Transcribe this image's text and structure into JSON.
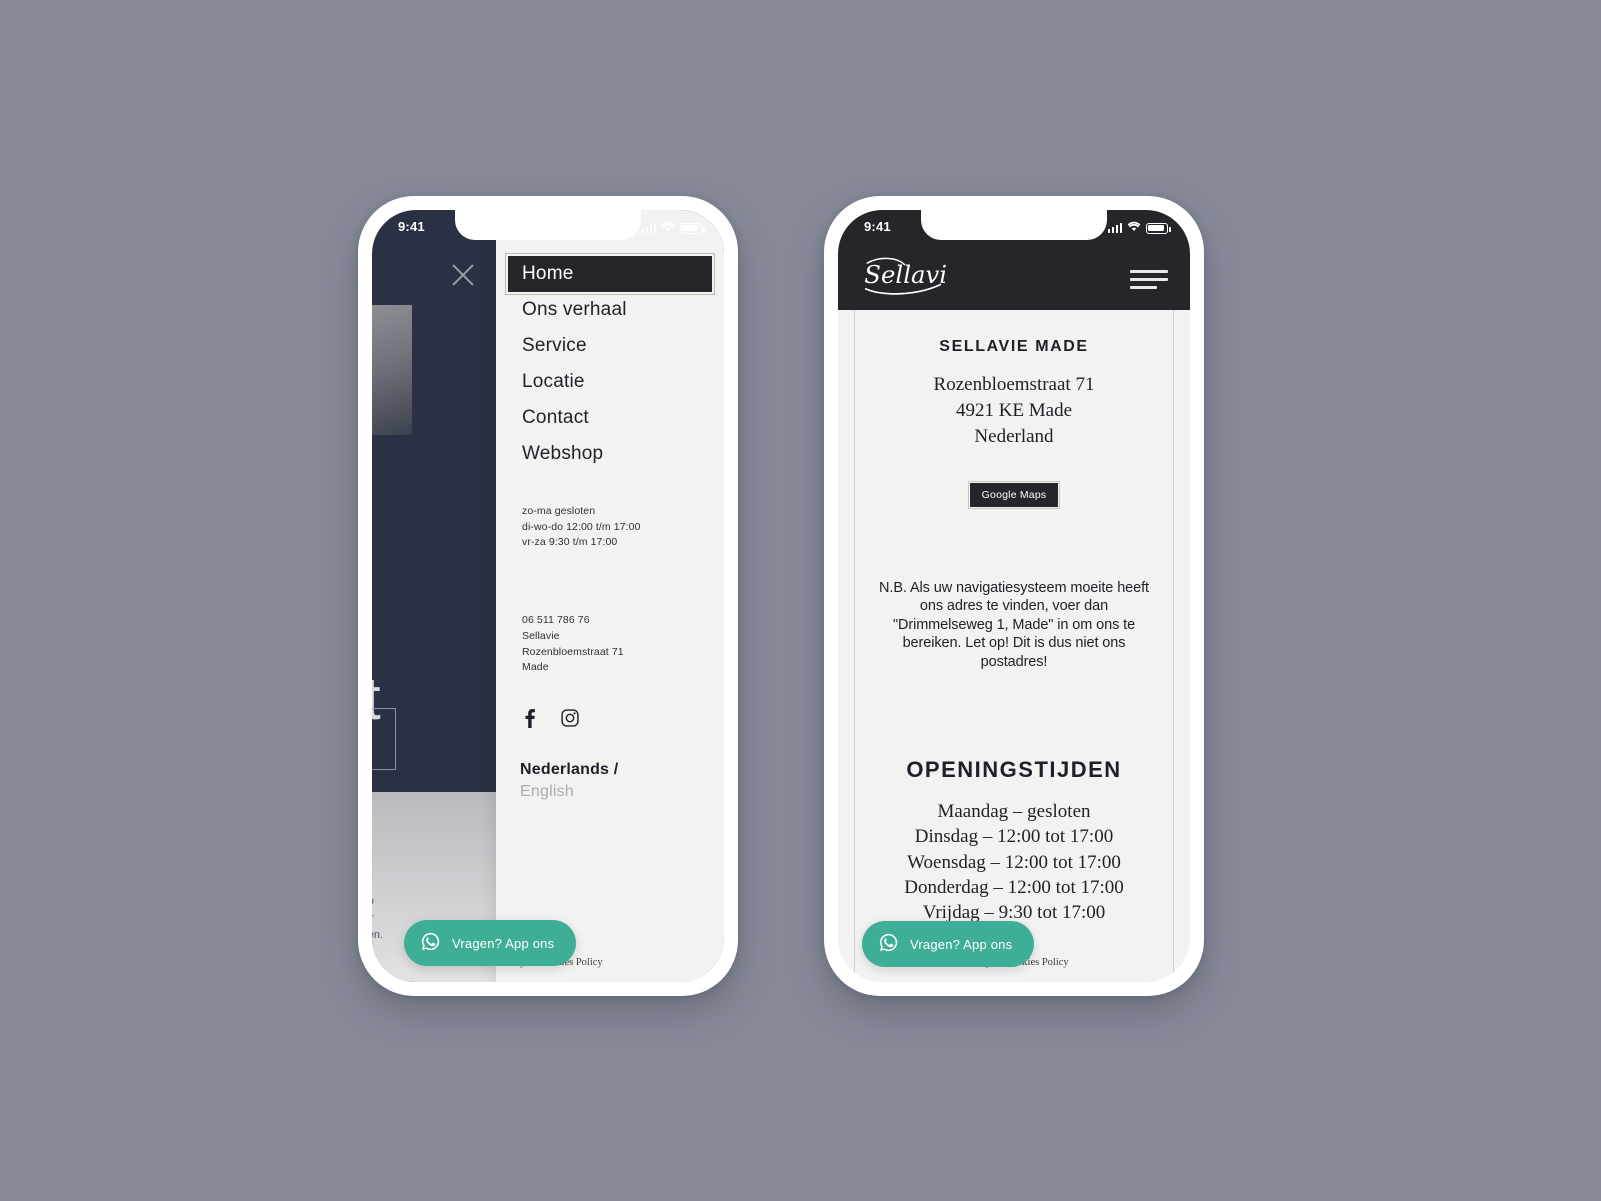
{
  "background_color": "#868a99",
  "accent_whatsapp": "#3fae96",
  "dark": "#26262a",
  "navy": "#2b3044",
  "phone_left": {
    "status": {
      "time": "9:41",
      "signal_icon": "cellular-signal-icon",
      "wifi_icon": "wifi-icon",
      "battery_icon": "battery-icon"
    },
    "close_icon": "close-icon",
    "hero": {
      "headline": "en\nen\nmst",
      "small_text": "roo\nner\nrgen."
    },
    "nav": {
      "items": [
        {
          "label": "Home",
          "active": true
        },
        {
          "label": "Ons verhaal",
          "active": false
        },
        {
          "label": "Service",
          "active": false
        },
        {
          "label": "Locatie",
          "active": false
        },
        {
          "label": "Contact",
          "active": false
        },
        {
          "label": "Webshop",
          "active": false
        }
      ]
    },
    "hours_summary": [
      "zo-ma gesloten",
      "di-wo-do 12:00 t/m 17:00",
      "vr-za 9:30 t/m 17:00"
    ],
    "contact": [
      "06 511 786 76",
      "Sellavie",
      "Rozenbloemstraat 71",
      "Made"
    ],
    "social": {
      "facebook_icon": "facebook-icon",
      "instagram_icon": "instagram-icon"
    },
    "language": {
      "primary": "Nederlands /",
      "secondary": "English"
    },
    "privacy": "Privacy & Cookies Policy",
    "whatsapp": {
      "label": "Vragen? App ons",
      "icon": "whatsapp-icon"
    }
  },
  "phone_right": {
    "status": {
      "time": "9:41",
      "signal_icon": "cellular-signal-icon",
      "wifi_icon": "wifi-icon",
      "battery_icon": "battery-icon"
    },
    "logo_text": "Sellavie",
    "menu_icon": "hamburger-menu-icon",
    "location": {
      "title": "SELLAVIE MADE",
      "address_lines": [
        "Rozenbloemstraat 71",
        "4921 KE Made",
        "Nederland"
      ],
      "maps_button": "Google Maps"
    },
    "note": "N.B. Als uw navigatiesysteem moeite heeft ons adres te vinden, voer dan \"Drimmelseweg 1, Made\" in om ons te bereiken. Let op! Dit is dus niet ons postadres!",
    "hours": {
      "title": "OPENINGSTIJDEN",
      "rows": [
        "Maandag – gesloten",
        "Dinsdag – 12:00 tot 17:00",
        "Woensdag – 12:00 tot 17:00",
        "Donderdag – 12:00 tot 17:00",
        "Vrijdag – 9:30 tot 17:00"
      ]
    },
    "privacy": "Privacy & Cookies Policy",
    "whatsapp": {
      "label": "Vragen? App ons",
      "icon": "whatsapp-icon"
    }
  }
}
